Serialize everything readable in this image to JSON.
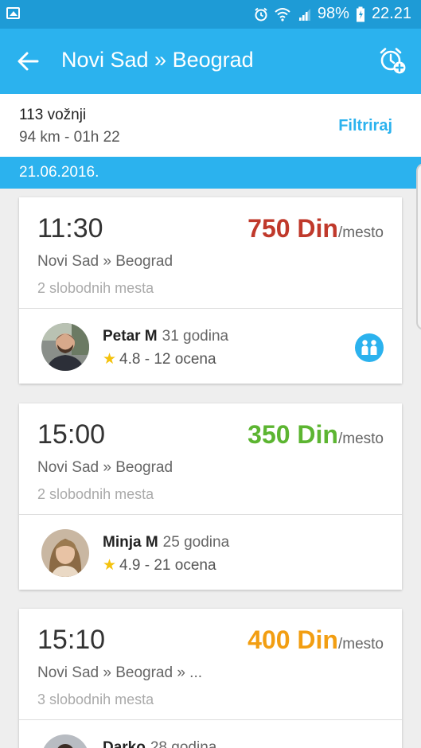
{
  "status_bar": {
    "icons": [
      "image-icon",
      "alarm-icon",
      "wifi-icon",
      "signal-icon",
      "battery-icon"
    ],
    "battery": "98%",
    "time": "22.21"
  },
  "app_bar": {
    "title": "Novi Sad » Beograd",
    "back_icon": "arrow-back-icon",
    "alarm_icon": "alarm-add-icon"
  },
  "summary": {
    "rides_count": "113 vožnji",
    "distance_duration": "94 km - 01h 22",
    "filter_label": "Filtriraj"
  },
  "date": "21.06.2016.",
  "rides": [
    {
      "time": "11:30",
      "price": "750 Din",
      "price_unit": "/mesto",
      "price_color": "#c0392b",
      "route": "Novi Sad » Beograd",
      "seats": "2 slobodnih mesta",
      "driver_name": "Petar M",
      "driver_age": "31 godina",
      "rating": "4.8 - 12 ocena",
      "icon": "people-icon"
    },
    {
      "time": "15:00",
      "price": "350 Din",
      "price_unit": "/mesto",
      "price_color": "#5cb531",
      "route": "Novi Sad » Beograd",
      "seats": "2 slobodnih mesta",
      "driver_name": "Minja M",
      "driver_age": "25 godina",
      "rating": "4.9 - 21 ocena"
    },
    {
      "time": "15:10",
      "price": "400 Din",
      "price_unit": "/mesto",
      "price_color": "#f29e12",
      "route": "Novi Sad » Beograd » ...",
      "seats": "3 slobodnih mesta",
      "driver_name": "Darko",
      "driver_age": "28 godina"
    }
  ],
  "colors": {
    "status_bar": "#1e9bd6",
    "app_bar": "#2bb2ee",
    "accent": "#2bb2ee"
  }
}
